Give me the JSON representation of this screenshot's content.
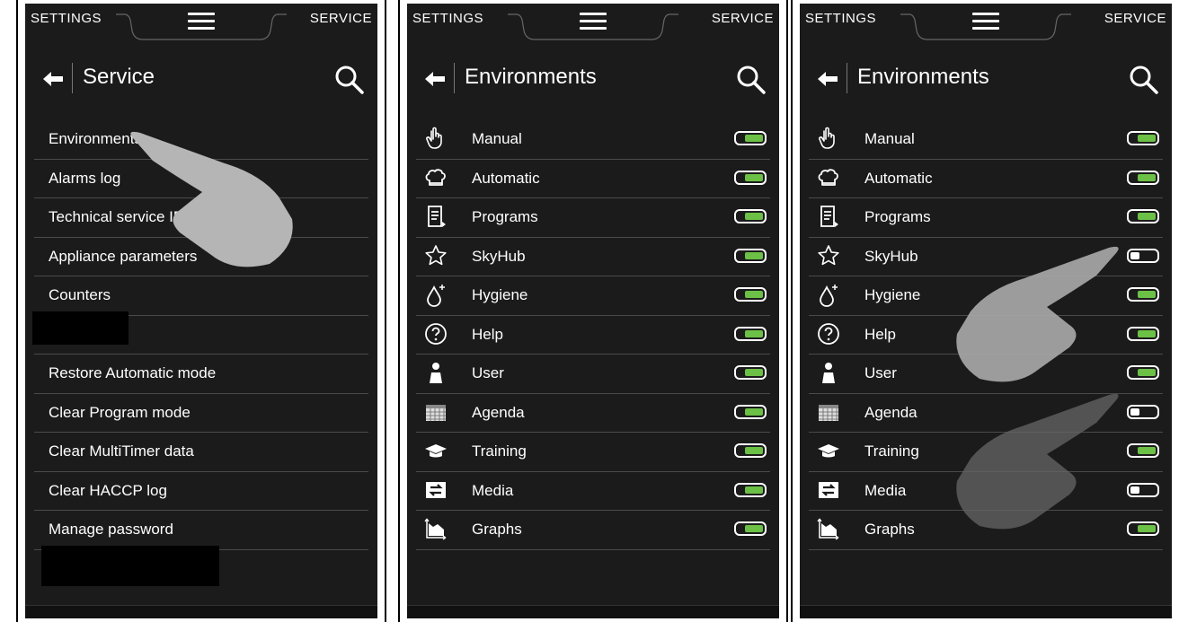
{
  "panel1": {
    "top_left": "SETTINGS",
    "top_right": "SERVICE",
    "title": "Service",
    "items": [
      {
        "label": "Environments"
      },
      {
        "label": "Alarms log"
      },
      {
        "label": "Technical service ID"
      },
      {
        "label": "Appliance parameters"
      },
      {
        "label": "Counters"
      },
      {
        "label": ""
      },
      {
        "label": "Restore Automatic mode"
      },
      {
        "label": "Clear Program mode"
      },
      {
        "label": "Clear MultiTimer data"
      },
      {
        "label": "Clear HACCP log"
      },
      {
        "label": "Manage password"
      }
    ]
  },
  "panel2": {
    "top_left": "SETTINGS",
    "top_right": "SERVICE",
    "title": "Environments",
    "items": [
      {
        "label": "Manual",
        "icon": "hand-pointer-icon",
        "on": true
      },
      {
        "label": "Automatic",
        "icon": "chef-hat-icon",
        "on": true
      },
      {
        "label": "Programs",
        "icon": "document-icon",
        "on": true
      },
      {
        "label": "SkyHub",
        "icon": "star-icon",
        "on": true
      },
      {
        "label": "Hygiene",
        "icon": "drop-sparkle-icon",
        "on": true
      },
      {
        "label": "Help",
        "icon": "question-circle-icon",
        "on": true
      },
      {
        "label": "User",
        "icon": "user-icon",
        "on": true
      },
      {
        "label": "Agenda",
        "icon": "calendar-icon",
        "on": true
      },
      {
        "label": "Training",
        "icon": "graduation-cap-icon",
        "on": true
      },
      {
        "label": "Media",
        "icon": "swap-arrows-icon",
        "on": true
      },
      {
        "label": "Graphs",
        "icon": "area-chart-icon",
        "on": true
      }
    ]
  },
  "panel3": {
    "top_left": "SETTINGS",
    "top_right": "SERVICE",
    "title": "Environments",
    "items": [
      {
        "label": "Manual",
        "icon": "hand-pointer-icon",
        "on": true
      },
      {
        "label": "Automatic",
        "icon": "chef-hat-icon",
        "on": true
      },
      {
        "label": "Programs",
        "icon": "document-icon",
        "on": true
      },
      {
        "label": "SkyHub",
        "icon": "star-icon",
        "on": false
      },
      {
        "label": "Hygiene",
        "icon": "drop-sparkle-icon",
        "on": true
      },
      {
        "label": "Help",
        "icon": "question-circle-icon",
        "on": true
      },
      {
        "label": "User",
        "icon": "user-icon",
        "on": true
      },
      {
        "label": "Agenda",
        "icon": "calendar-icon",
        "on": false
      },
      {
        "label": "Training",
        "icon": "graduation-cap-icon",
        "on": true
      },
      {
        "label": "Media",
        "icon": "swap-arrows-icon",
        "on": false
      },
      {
        "label": "Graphs",
        "icon": "area-chart-icon",
        "on": true
      }
    ]
  },
  "colors": {
    "bg": "#1b1b1b",
    "toggle_on": "#6bc045",
    "text": "#ffffff"
  }
}
